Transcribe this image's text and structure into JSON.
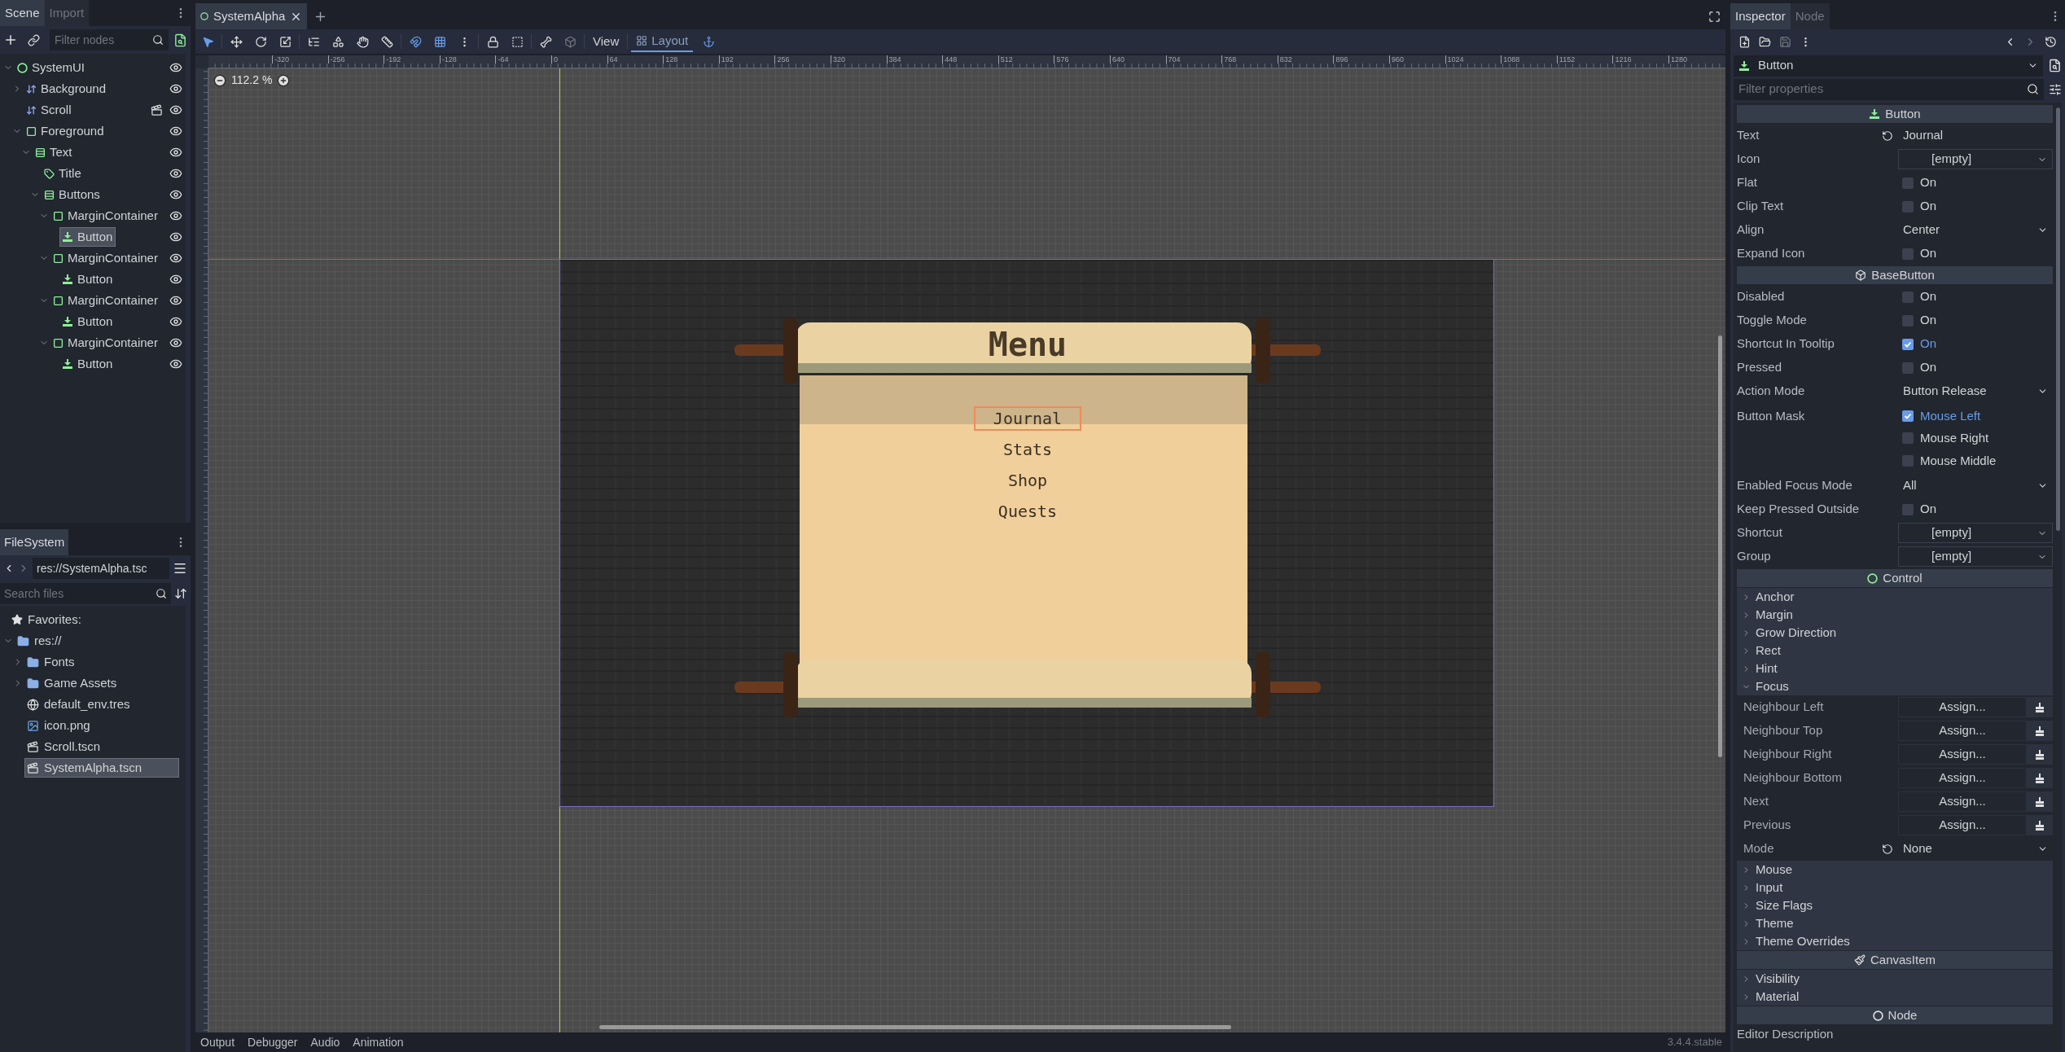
{
  "scene_dock": {
    "tabs": [
      {
        "label": "Scene",
        "selected": true
      },
      {
        "label": "Import",
        "selected": false
      }
    ],
    "filter_placeholder": "Filter nodes",
    "tree": [
      {
        "name": "SystemUI",
        "kind": "root",
        "expanded": true,
        "selected": false,
        "children": [
          {
            "name": "Background",
            "kind": "sort",
            "expanded": false,
            "selected": false
          },
          {
            "name": "Scroll",
            "kind": "sort",
            "selected": false,
            "instanced": true
          },
          {
            "name": "Foreground",
            "kind": "control",
            "expanded": true,
            "selected": false,
            "children": [
              {
                "name": "Text",
                "kind": "vbox",
                "expanded": true,
                "selected": false,
                "children": [
                  {
                    "name": "Title",
                    "kind": "label",
                    "selected": false
                  },
                  {
                    "name": "Buttons",
                    "kind": "vbox",
                    "expanded": true,
                    "selected": false,
                    "children": [
                      {
                        "name": "MarginContainer",
                        "kind": "control",
                        "expanded": true,
                        "selected": false,
                        "children": [
                          {
                            "name": "Button",
                            "kind": "button",
                            "selected": true
                          }
                        ]
                      },
                      {
                        "name": "MarginContainer",
                        "kind": "control",
                        "expanded": true,
                        "selected": false,
                        "children": [
                          {
                            "name": "Button",
                            "kind": "button",
                            "selected": false
                          }
                        ]
                      },
                      {
                        "name": "MarginContainer",
                        "kind": "control",
                        "expanded": true,
                        "selected": false,
                        "children": [
                          {
                            "name": "Button",
                            "kind": "button",
                            "selected": false
                          }
                        ]
                      },
                      {
                        "name": "MarginContainer",
                        "kind": "control",
                        "expanded": true,
                        "selected": false,
                        "children": [
                          {
                            "name": "Button",
                            "kind": "button",
                            "selected": false
                          }
                        ]
                      }
                    ]
                  }
                ]
              }
            ]
          }
        ]
      }
    ]
  },
  "filesystem": {
    "tab": "FileSystem",
    "path": "res://SystemAlpha.tsc",
    "search_placeholder": "Search files",
    "favorites": "Favorites:",
    "tree": [
      {
        "name": "res://",
        "kind": "folder",
        "expanded": true,
        "selected": false,
        "children": [
          {
            "name": "Fonts",
            "kind": "folder",
            "expanded": false,
            "selected": false
          },
          {
            "name": "Game Assets",
            "kind": "folder",
            "expanded": false,
            "selected": false
          },
          {
            "name": "default_env.tres",
            "kind": "resource",
            "selected": false
          },
          {
            "name": "icon.png",
            "kind": "image",
            "selected": false
          },
          {
            "name": "Scroll.tscn",
            "kind": "scene",
            "selected": false
          },
          {
            "name": "SystemAlpha.tscn",
            "kind": "scene",
            "selected": true
          }
        ]
      }
    ]
  },
  "editor": {
    "tabs": [
      {
        "label": "SystemAlpha",
        "selected": true
      }
    ],
    "toolbar_buttons": [
      "View",
      "Layout"
    ],
    "zoom": "112.2 %",
    "ruler_labels": [
      "-320",
      "-256",
      "-192",
      "-128",
      "-64",
      "0",
      "64",
      "128",
      "192",
      "256",
      "320",
      "384",
      "448",
      "512",
      "576",
      "640",
      "704",
      "768",
      "832",
      "896",
      "960",
      "1024",
      "1088",
      "1152",
      "1216",
      "1280"
    ],
    "game": {
      "title": "Menu",
      "buttons": [
        {
          "label": "Journal",
          "selected": true
        },
        {
          "label": "Stats",
          "selected": false
        },
        {
          "label": "Shop",
          "selected": false
        },
        {
          "label": "Quests",
          "selected": false
        }
      ]
    }
  },
  "bottom_panel": {
    "tabs": [
      "Output",
      "Debugger",
      "Audio",
      "Animation"
    ],
    "version": "3.4.4.stable"
  },
  "inspector": {
    "tabs": [
      {
        "label": "Inspector",
        "selected": true
      },
      {
        "label": "Node",
        "selected": false
      }
    ],
    "object": "Button",
    "filter_placeholder": "Filter properties",
    "items": [
      {
        "kind": "section",
        "title": "Button"
      },
      {
        "kind": "text",
        "label": "Text",
        "value": "Journal",
        "revertable": true
      },
      {
        "kind": "resource",
        "label": "Icon",
        "value": "[empty]"
      },
      {
        "kind": "check",
        "label": "Flat",
        "option": "On",
        "checked": false
      },
      {
        "kind": "check",
        "label": "Clip Text",
        "option": "On",
        "checked": false
      },
      {
        "kind": "enum",
        "label": "Align",
        "value": "Center"
      },
      {
        "kind": "check",
        "label": "Expand Icon",
        "option": "On",
        "checked": false
      },
      {
        "kind": "section",
        "title": "BaseButton"
      },
      {
        "kind": "check",
        "label": "Disabled",
        "option": "On",
        "checked": false
      },
      {
        "kind": "check",
        "label": "Toggle Mode",
        "option": "On",
        "checked": false
      },
      {
        "kind": "check",
        "label": "Shortcut In Tooltip",
        "option": "On",
        "checked": true
      },
      {
        "kind": "check",
        "label": "Pressed",
        "option": "On",
        "checked": false
      },
      {
        "kind": "enum",
        "label": "Action Mode",
        "value": "Button Release"
      },
      {
        "kind": "flags",
        "label": "Button Mask",
        "options": [
          {
            "label": "Mouse Left",
            "checked": true
          },
          {
            "label": "Mouse Right",
            "checked": false
          },
          {
            "label": "Mouse Middle",
            "checked": false
          }
        ]
      },
      {
        "kind": "enum",
        "label": "Enabled Focus Mode",
        "value": "All"
      },
      {
        "kind": "check",
        "label": "Keep Pressed Outside",
        "option": "On",
        "checked": false
      },
      {
        "kind": "resource",
        "label": "Shortcut",
        "value": "[empty]"
      },
      {
        "kind": "resource",
        "label": "Group",
        "value": "[empty]"
      },
      {
        "kind": "section",
        "title": "Control"
      },
      {
        "kind": "group",
        "label": "Anchor",
        "expanded": false
      },
      {
        "kind": "group",
        "label": "Margin",
        "expanded": false
      },
      {
        "kind": "group",
        "label": "Grow Direction",
        "expanded": false
      },
      {
        "kind": "group",
        "label": "Rect",
        "expanded": false
      },
      {
        "kind": "group",
        "label": "Hint",
        "expanded": false
      },
      {
        "kind": "group",
        "label": "Focus",
        "expanded": true,
        "children": [
          {
            "kind": "assign",
            "label": "Neighbour Left",
            "value": "Assign..."
          },
          {
            "kind": "assign",
            "label": "Neighbour Top",
            "value": "Assign..."
          },
          {
            "kind": "assign",
            "label": "Neighbour Right",
            "value": "Assign..."
          },
          {
            "kind": "assign",
            "label": "Neighbour Bottom",
            "value": "Assign..."
          },
          {
            "kind": "assign",
            "label": "Next",
            "value": "Assign..."
          },
          {
            "kind": "assign",
            "label": "Previous",
            "value": "Assign..."
          },
          {
            "kind": "enum",
            "label": "Mode",
            "value": "None",
            "revertable": true
          }
        ]
      },
      {
        "kind": "group",
        "label": "Mouse",
        "expanded": false
      },
      {
        "kind": "group",
        "label": "Input",
        "expanded": false
      },
      {
        "kind": "group",
        "label": "Size Flags",
        "expanded": false
      },
      {
        "kind": "group",
        "label": "Theme",
        "expanded": false
      },
      {
        "kind": "group",
        "label": "Theme Overrides",
        "expanded": false
      },
      {
        "kind": "section",
        "title": "CanvasItem"
      },
      {
        "kind": "group",
        "label": "Visibility",
        "expanded": false
      },
      {
        "kind": "group",
        "label": "Material",
        "expanded": false
      },
      {
        "kind": "section",
        "title": "Node"
      },
      {
        "kind": "label",
        "label": "Editor Description"
      }
    ]
  }
}
